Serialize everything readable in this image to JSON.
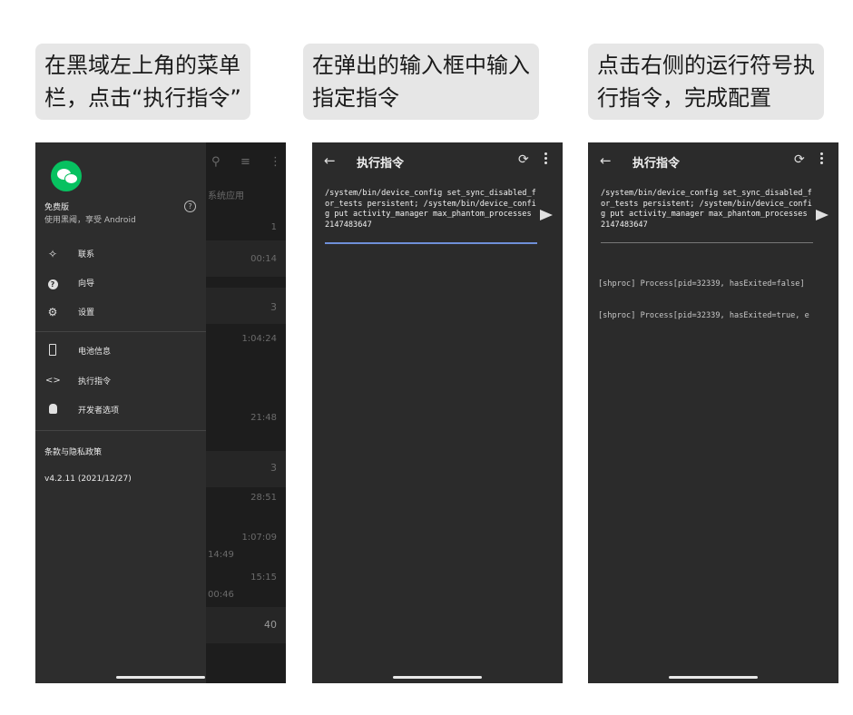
{
  "captions": [
    {
      "line1": "在黑域左上角的菜单",
      "line2": "栏，点击“执行指令”"
    },
    {
      "line1": "在弹出的输入框中输入",
      "line2": "指定指令"
    },
    {
      "line1": "点击右侧的运行符号执",
      "line2": "行指令，完成配置"
    }
  ],
  "drawer": {
    "version_name": "免费版",
    "version_sub": "使用黑阈，享受 Android",
    "items": [
      {
        "icon": "contact-icon",
        "label": "联系"
      },
      {
        "icon": "help-circle-icon",
        "label": "向导"
      },
      {
        "icon": "gear-icon",
        "label": "设置"
      },
      {
        "icon": "battery-icon",
        "label": "电池信息"
      },
      {
        "icon": "code-icon",
        "label": "执行指令"
      },
      {
        "icon": "android-icon",
        "label": "开发者选项"
      }
    ],
    "terms": "条款与隐私政策",
    "version": "v4.2.11 (2021/12/27)"
  },
  "background_list": {
    "header": "系统应用",
    "values": [
      "1",
      "00:14",
      "3",
      "1:04:24",
      "21:48",
      "3",
      "28:51",
      "1:07:09",
      "14:49",
      "15:15",
      "00:46",
      "40"
    ]
  },
  "exec": {
    "title": "执行指令",
    "command": "/system/bin/device_config set_sync_disabled_for_tests persistent; /system/bin/device_config put activity_manager max_phantom_processes 2147483647",
    "output": [
      "[shproc] Process[pid=32339, hasExited=false]",
      "[shproc] Process[pid=32339, hasExited=true, e"
    ]
  },
  "colors": {
    "accent_underline": "#6f8fd8",
    "wechat_green": "#07c160"
  }
}
